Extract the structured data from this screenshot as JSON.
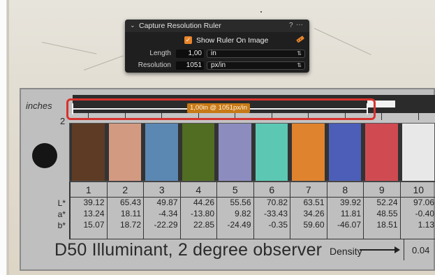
{
  "panel": {
    "title": "Capture Resolution Ruler",
    "help": "?",
    "more": "···",
    "show_ruler_checked": true,
    "show_ruler_label": "Show Ruler On Image",
    "length_label": "Length",
    "length_value": "1,00",
    "length_unit": "in",
    "resolution_label": "Resolution",
    "resolution_value": "1051",
    "resolution_unit": "px/in",
    "icons": {
      "chevron": "chevron-down-icon",
      "ruler": "ruler-icon"
    },
    "accent": "#e8842a"
  },
  "ruler_overlay": {
    "label": "1,00in @ 1051px/in",
    "highlight_color": "#d8332e"
  },
  "target": {
    "units_label": "inches",
    "scale_start": "2",
    "patch_colors": [
      "#5e3b24",
      "#d39a82",
      "#5b87b3",
      "#506d22",
      "#8c8cbf",
      "#5cc8b4",
      "#e0832f",
      "#4c5eb8",
      "#d04a52",
      "#e8e8e8"
    ],
    "columns": [
      "1",
      "2",
      "3",
      "4",
      "5",
      "6",
      "7",
      "8",
      "9",
      "10"
    ],
    "row_labels": [
      "L*",
      "a*",
      "b*"
    ],
    "L": [
      "39.12",
      "65.43",
      "49.87",
      "44.26",
      "55.56",
      "70.82",
      "63.51",
      "39.92",
      "52.24",
      "97.06"
    ],
    "a": [
      "13.24",
      "18.11",
      "-4.34",
      "-13.80",
      "9.82",
      "-33.43",
      "34.26",
      "11.81",
      "48.55",
      "-0.40"
    ],
    "b": [
      "15.07",
      "18.72",
      "-22.29",
      "22.85",
      "-24.49",
      "-0.35",
      "59.60",
      "-46.07",
      "18.51",
      "1.13"
    ],
    "footer": "D50 Illuminant, 2 degree observer",
    "density_label": "Density",
    "density_value": "0.04"
  }
}
